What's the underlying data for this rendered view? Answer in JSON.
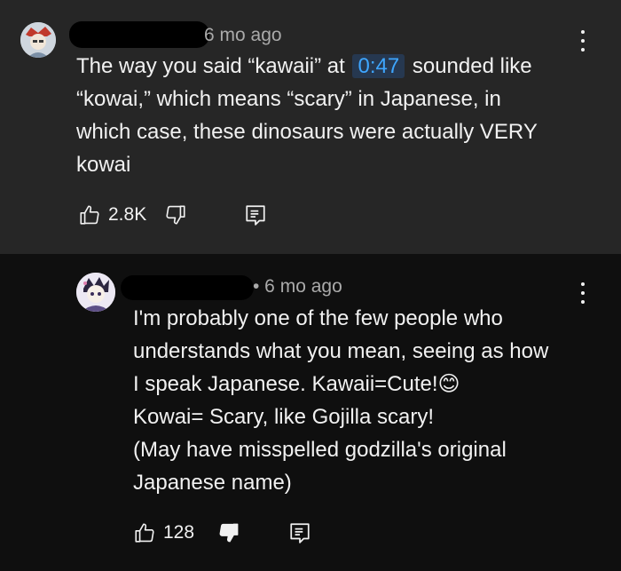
{
  "top_comment": {
    "author_redacted": true,
    "time_ago": "6 mo ago",
    "text_before_link": "The way you said “kawaii” at",
    "timestamp_link": "0:47",
    "text_after_link": "sounded like",
    "lines": [
      "“kowai,” which means “scary” in Japanese, in",
      "which case, these dinosaurs were actually VERY",
      "kowai"
    ],
    "like_count": "2.8K",
    "disliked": false,
    "icons": [
      "avatar",
      "more-vert-icon",
      "thumb-up-icon",
      "thumb-down-icon",
      "reply-icon"
    ]
  },
  "reply": {
    "author_redacted": true,
    "time_ago": "• 6 mo ago",
    "lines": [
      "I'm probably one of the few people who",
      "understands what you mean, seeing as how",
      "I speak Japanese. Kawaii=Cute!",
      "Kowai= Scary, like Gojilla scary!",
      "(May have misspelled godzilla's original",
      "Japanese name)"
    ],
    "emoji": "😊",
    "like_count": "128",
    "disliked": true,
    "icons": [
      "avatar",
      "more-vert-icon",
      "thumb-up-icon",
      "thumb-down-filled-icon",
      "reply-icon"
    ]
  },
  "colors": {
    "top_background": "#262626",
    "reply_background": "#0f0f0f",
    "text": "#f1f1f1",
    "meta_text": "#aaaaaa",
    "link": "#3ea6ff",
    "link_background": "#263850"
  }
}
